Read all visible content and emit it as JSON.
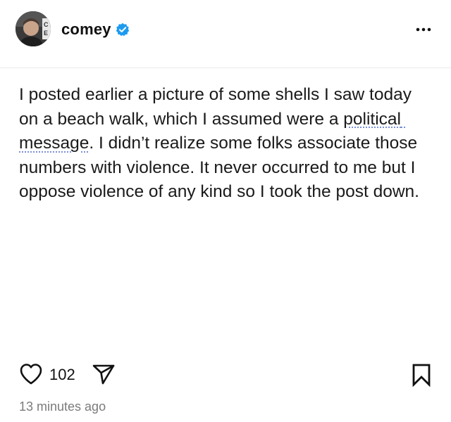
{
  "header": {
    "username": "comey",
    "avatar_icon": "profile-photo",
    "verified_icon": "verified-badge-icon",
    "more_icon": "more-options-icon"
  },
  "post": {
    "text_segments": [
      {
        "text": "I posted earlier a picture of some shells I saw today on a beach walk, which I assumed were a ",
        "style": "plain"
      },
      {
        "text": "political message",
        "style": "link"
      },
      {
        "text": ". I didn’t realize some folks associate those numbers with violence. It never occurred to me but I oppose violence of any kind so I took the post down.",
        "style": "plain"
      }
    ]
  },
  "actions": {
    "like_count": "102",
    "like_icon": "heart-icon",
    "share_icon": "paper-plane-icon",
    "bookmark_icon": "bookmark-icon"
  },
  "timestamp": "13 minutes ago",
  "colors": {
    "verified_blue": "#1d9bf0",
    "link_underline": "#7a8fd6",
    "timestamp_gray": "#7b7b7b"
  }
}
